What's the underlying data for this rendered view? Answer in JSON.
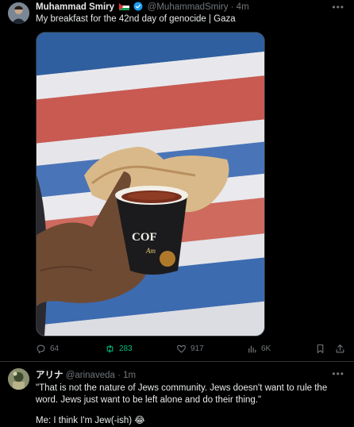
{
  "tweet1": {
    "display_name": "Muhammad Smiry",
    "flag_icon": "palestine-flag-icon",
    "verified_icon": "verified-badge-icon",
    "handle_time": "@MuhammadSmiry · 4m",
    "more_label": "•••",
    "text": "My breakfast for the 42nd day of genocide | Gaza",
    "media": {
      "icon": "photo",
      "cup_text": "COF",
      "cup_subtext": "Am"
    },
    "actions": {
      "reply_count": "64",
      "retweet_count": "283",
      "like_count": "917",
      "views_count": "6K"
    },
    "colors": {
      "retweet_active": "#00ba7c",
      "muted": "#71767b"
    }
  },
  "tweet2": {
    "display_name": "アリナ",
    "handle_time": "@arinaveda · 1m",
    "more_label": "•••",
    "text": "\"That is not the nature of Jews community. Jews doesn't want to rule the word. Jews just want to be left alone and do their thing.\"",
    "text2": "Me: I think I'm Jew(-ish) 😂"
  }
}
